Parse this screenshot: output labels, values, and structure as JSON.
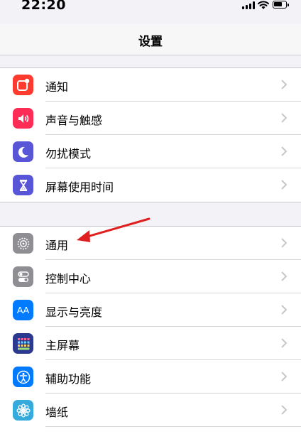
{
  "status_bar": {
    "time": "22:20"
  },
  "nav": {
    "title": "设置"
  },
  "groups": [
    {
      "items": [
        {
          "label": "通知",
          "icon": "notifications-icon",
          "color": "#ff3b30"
        },
        {
          "label": "声音与触感",
          "icon": "sound-icon",
          "color": "#ff2d55"
        },
        {
          "label": "勿扰模式",
          "icon": "moon-icon",
          "color": "#5856d6"
        },
        {
          "label": "屏幕使用时间",
          "icon": "hourglass-icon",
          "color": "#5856d6"
        }
      ]
    },
    {
      "items": [
        {
          "label": "通用",
          "icon": "gear-icon",
          "color": "#8e8e93"
        },
        {
          "label": "控制中心",
          "icon": "control-center-icon",
          "color": "#8e8e93"
        },
        {
          "label": "显示与亮度",
          "icon": "display-icon",
          "color": "#007aff"
        },
        {
          "label": "主屏幕",
          "icon": "home-screen-icon",
          "color": "#0a84ff"
        },
        {
          "label": "辅助功能",
          "icon": "accessibility-icon",
          "color": "#007aff"
        },
        {
          "label": "墙纸",
          "icon": "wallpaper-icon",
          "color": "#35aadc"
        }
      ]
    }
  ],
  "annotation": {
    "icon": "red-arrow-icon",
    "color": "#e02020"
  }
}
